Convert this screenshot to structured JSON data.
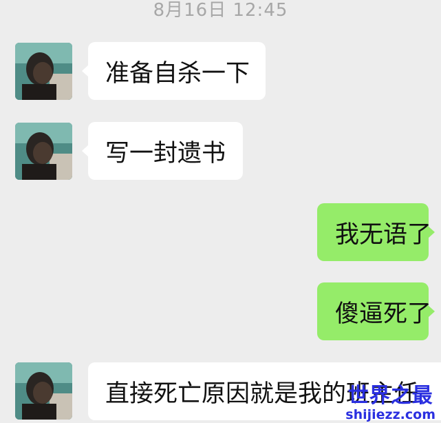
{
  "chat": {
    "timestamp": "8月16日 12:45",
    "messages": [
      {
        "sender": "contact",
        "text": "准备自杀一下"
      },
      {
        "sender": "contact",
        "text": "写一封遗书"
      },
      {
        "sender": "self",
        "text": "我无语了"
      },
      {
        "sender": "self",
        "text": "傻逼死了"
      },
      {
        "sender": "contact",
        "text": "直接死亡原因就是我的班主任"
      }
    ]
  },
  "watermark": {
    "main": "世界之最",
    "url": "shijiezz.com"
  },
  "colors": {
    "background": "#ededed",
    "incoming_bubble": "#ffffff",
    "outgoing_bubble": "#95ec69",
    "watermark": "#2a2fe0"
  },
  "icons": {
    "avatar": "contact-photo"
  }
}
